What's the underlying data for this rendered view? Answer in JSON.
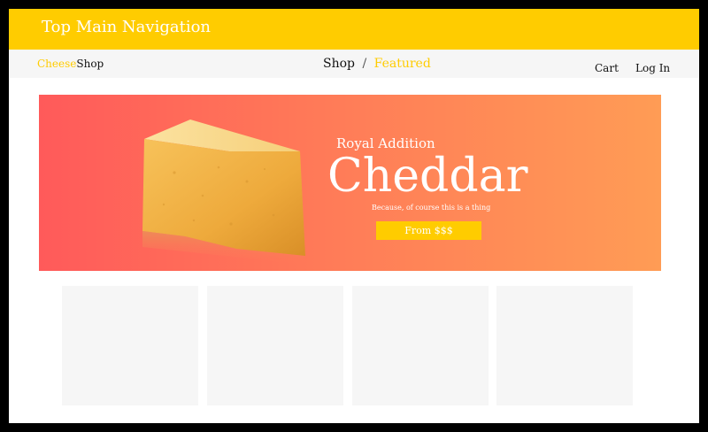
{
  "top_nav": {
    "title": "Top Main Navigation"
  },
  "sub_nav": {
    "logo": {
      "part1": "Cheese",
      "part2": "Shop"
    },
    "breadcrumb": {
      "shop": "Shop",
      "separator": "/",
      "featured": "Featured"
    },
    "links": {
      "cart": "Cart",
      "login": "Log In"
    }
  },
  "hero": {
    "eyebrow": "Royal Addition",
    "title": "Cheddar",
    "tagline": "Because, of course this is a thing",
    "cta_label": "From $$$",
    "image_icon": "cheddar-wedge-image"
  },
  "product_cards_count": 4,
  "colors": {
    "accent": "#ffcc00",
    "hero_gradient_start": "#ff5a5a",
    "hero_gradient_end": "#ff9c55",
    "placeholder": "#f6f6f6"
  }
}
